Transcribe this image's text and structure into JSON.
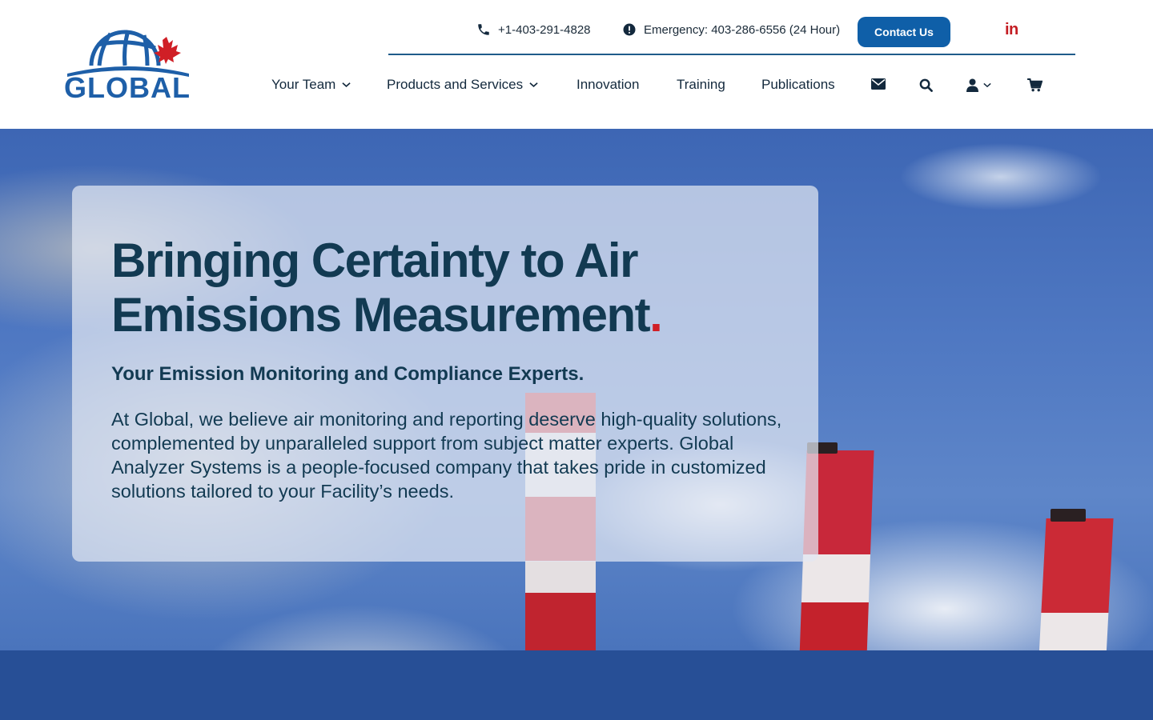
{
  "logo": {
    "text": "GLOBAL",
    "icon": "globe-maple-leaf-logo"
  },
  "topbar": {
    "phone": {
      "icon": "phone-icon",
      "text": "+1-403-291-4828"
    },
    "emergency": {
      "icon": "exclamation-circle-icon",
      "text": "Emergency: 403-286-6556 (24 Hour)"
    },
    "contact_label": "Contact Us",
    "linkedin_label": "in"
  },
  "nav": {
    "items": [
      {
        "label": "Your Team",
        "has_dropdown": true
      },
      {
        "label": "Products and Services",
        "has_dropdown": true
      },
      {
        "label": "Innovation",
        "has_dropdown": false
      },
      {
        "label": "Training",
        "has_dropdown": false
      },
      {
        "label": "Publications",
        "has_dropdown": false
      }
    ],
    "icons": [
      "envelope-icon",
      "search-icon",
      "user-icon",
      "cart-icon"
    ]
  },
  "hero": {
    "title_line1": "Bringing Certainty to Air",
    "title_line2": "Emissions Measurement",
    "title_dot": ".",
    "subtitle": "Your Emission Monitoring and Compliance Experts.",
    "body": "At Global, we believe air monitoring and reporting deserve high-quality solutions, complemented by unparalleled support from subject matter experts. Global Analyzer Systems is a people-focused company that takes pride in customized solutions tailored to your Facility’s needs."
  },
  "colors": {
    "brand_blue": "#0f5fa8",
    "heading": "#123a52",
    "accent_red": "#d01f26",
    "footer_band": "#274f96"
  }
}
